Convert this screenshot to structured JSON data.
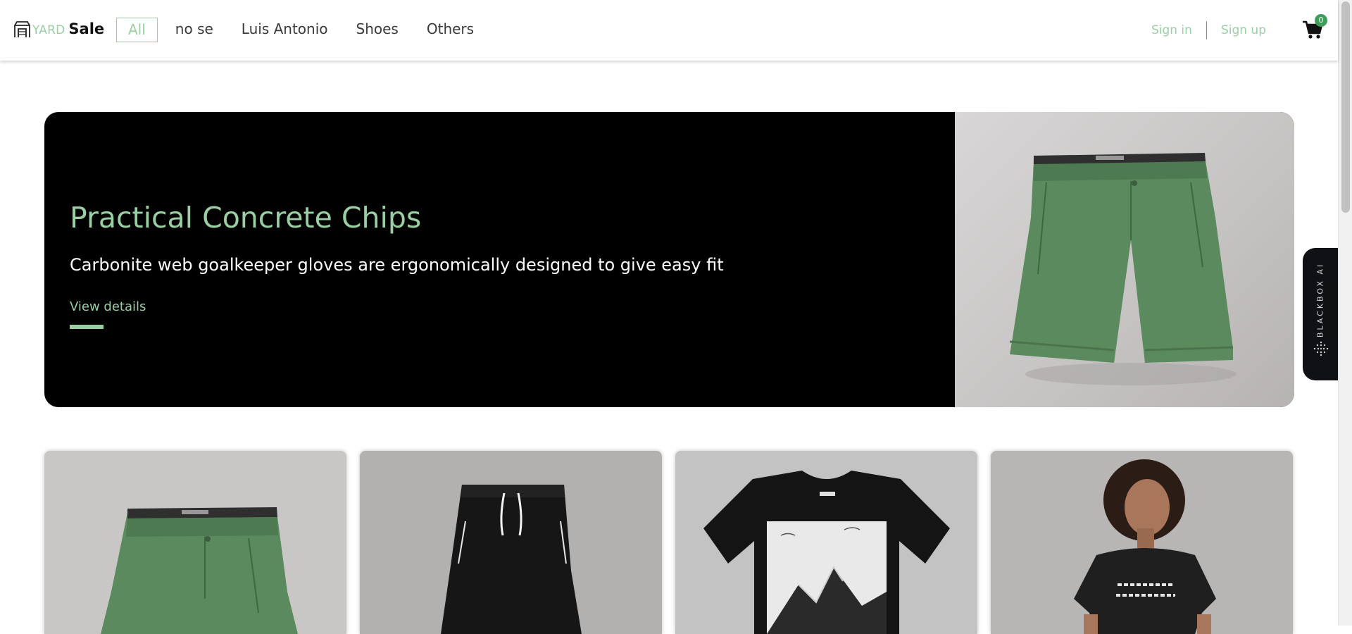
{
  "brand": {
    "part1": "YARD",
    "part2": "Sale",
    "icon": "storefront-icon"
  },
  "nav": {
    "items": [
      {
        "label": "All",
        "active": true
      },
      {
        "label": "no se",
        "active": false
      },
      {
        "label": "Luis Antonio",
        "active": false
      },
      {
        "label": "Shoes",
        "active": false
      },
      {
        "label": "Others",
        "active": false
      }
    ]
  },
  "auth": {
    "sign_in": "Sign in",
    "sign_up": "Sign up"
  },
  "cart": {
    "count": "0",
    "icon": "shopping-cart-icon"
  },
  "hero": {
    "title": "Practical Concrete Chips",
    "description": "Carbonite web goalkeeper gloves are ergonomically designed to give easy fit",
    "link_label": "View details",
    "image": "green-shorts-photo"
  },
  "products": [
    {
      "image": "green-shorts-photo"
    },
    {
      "image": "black-joggers-photo"
    },
    {
      "image": "mountain-graphic-tshirt-photo"
    },
    {
      "image": "woman-black-tshirt-photo"
    }
  ],
  "blackbox": {
    "label": "BLACKBOX AI",
    "icon": "blackbox-dots-icon"
  },
  "colors": {
    "accent": "#9acfa3",
    "badge": "#3f9d5a",
    "hero_bg": "#000000",
    "text_dark": "#3a3a3a"
  }
}
